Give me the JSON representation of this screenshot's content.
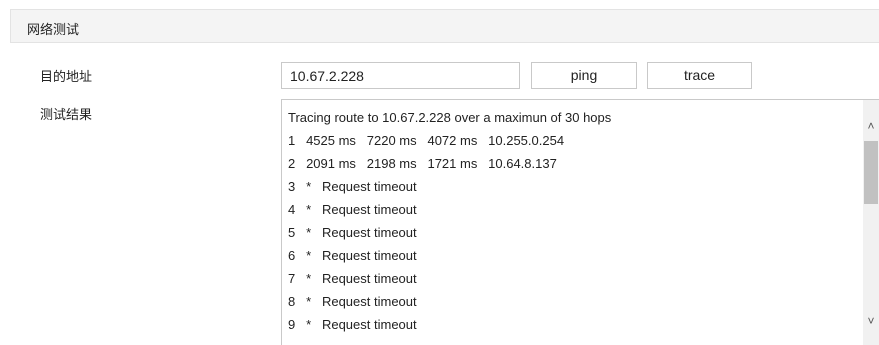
{
  "section": {
    "title": "网络测试"
  },
  "form": {
    "destination_label": "目的地址",
    "result_label": "测试结果",
    "address_value": "10.67.2.228",
    "ping_label": "ping",
    "trace_label": "trace"
  },
  "result": {
    "lines": [
      "Tracing route to 10.67.2.228 over a maximun of 30 hops",
      "1   4525 ms   7220 ms   4072 ms   10.255.0.254",
      "2   2091 ms   2198 ms   1721 ms   10.64.8.137",
      "3   *   Request timeout",
      "4   *   Request timeout",
      "5   *   Request timeout",
      "6   *   Request timeout",
      "7   *   Request timeout",
      "8   *   Request timeout",
      "9   *   Request timeout"
    ]
  },
  "scrollbar": {
    "up_icon": "chevron-up-icon",
    "down_icon": "chevron-down-icon"
  }
}
